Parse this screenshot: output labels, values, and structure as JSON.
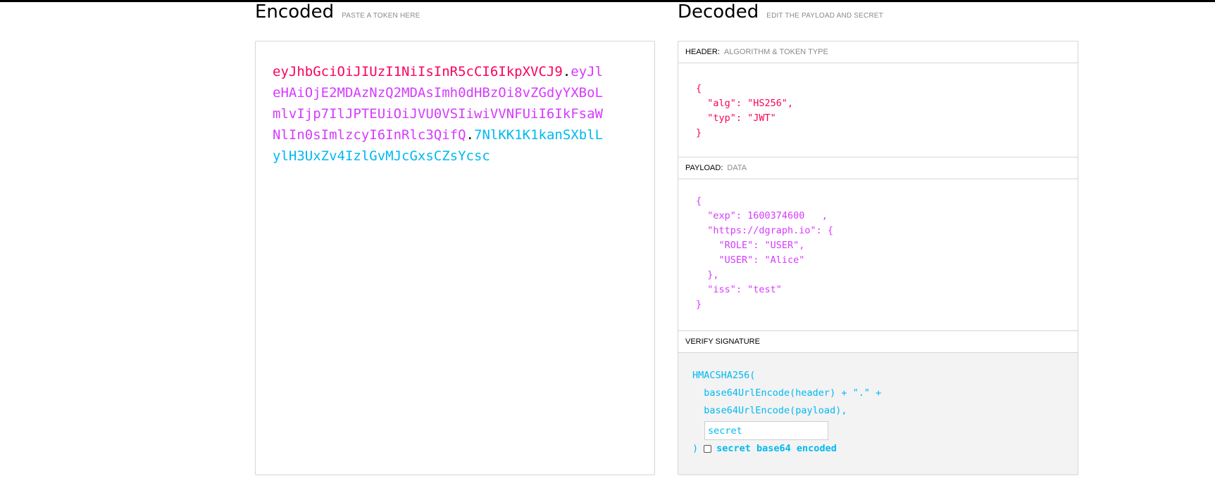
{
  "encoded": {
    "title": "Encoded",
    "subtitle": "PASTE A TOKEN HERE",
    "token": {
      "header": "eyJhbGciOiJIUzI1NiIsInR5cCI6IkpXVCJ9",
      "payload": "eyJleHAiOjE2MDAzNzQ2MDAsImh0dHBzOi8vZGdyYXBoLmlvIjp7IlJPTEUiOiJVU0VSIiwiVVNFUiI6IkFsaWNlIn0sImlzcyI6InRlc3QifQ",
      "signature": "7NlKK1K1kanSXblLylH3UxZv4IzlGvMJcGxsCZsYcsc"
    }
  },
  "decoded": {
    "title": "Decoded",
    "subtitle": "EDIT THE PAYLOAD AND SECRET",
    "header_section": {
      "label": "HEADER:",
      "sublabel": "ALGORITHM & TOKEN TYPE",
      "json": "{\n  \"alg\": \"HS256\",\n  \"typ\": \"JWT\"\n}"
    },
    "payload_section": {
      "label": "PAYLOAD:",
      "sublabel": "DATA",
      "json": "{\n  \"exp\": 1600374600   ,\n  \"https://dgraph.io\": {\n    \"ROLE\": \"USER\",\n    \"USER\": \"Alice\"\n  },\n  \"iss\": \"test\"\n}"
    },
    "verify_section": {
      "label": "VERIFY SIGNATURE",
      "code": "HMACSHA256(\n  base64UrlEncode(header) + \".\" +\n  base64UrlEncode(payload),",
      "secret_value": "secret",
      "close_paren": ")",
      "base64_label": "secret base64 encoded"
    }
  },
  "colors": {
    "header": "#fb015b",
    "payload": "#d63aff",
    "signature": "#00b9f1"
  }
}
